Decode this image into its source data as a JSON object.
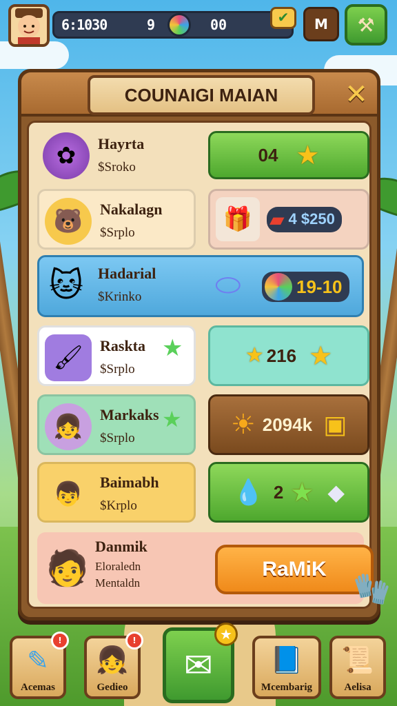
{
  "hud": {
    "score": "6:1030",
    "level": "9",
    "counter": "00",
    "menu_label": "M",
    "check_icon": "checkmark-icon",
    "tool_icon": "hammer-icon"
  },
  "panel": {
    "title": "COUNAIGI MAIAN",
    "close_label": "✕"
  },
  "rows": [
    {
      "name": "Hayrta",
      "sub": "$Sroko",
      "value": "04",
      "icon": "puzzle-pieces-icon"
    },
    {
      "name": "Nakalagn",
      "sub": "$Srplo",
      "value": "4 $250",
      "icon": "bear-icon"
    },
    {
      "name": "Hadarial",
      "sub": "$Krinko",
      "value": "19-10",
      "icon": "cat-icon"
    },
    {
      "name": "Raskta",
      "sub": "$Srplo",
      "value": "216",
      "icon": "brush-gem-icon"
    },
    {
      "name": "Markaks",
      "sub": "$Srplo",
      "value": "2094k",
      "icon": "girl-avatar-icon"
    },
    {
      "name": "Baimabh",
      "sub": "$Krplo",
      "value": "2",
      "icon": "boy-avatar-icon"
    },
    {
      "name": "Danmik",
      "sub": "Eloraledn",
      "sub2": "Mentaldn",
      "value": "RaMiK",
      "icon": "character-avatar-icon"
    }
  ],
  "nav": {
    "items": [
      {
        "label": "Acemas",
        "icon": "tool-icon",
        "badge": "!"
      },
      {
        "label": "Gedieo",
        "icon": "friend-icon",
        "badge": "!"
      },
      {
        "label": "",
        "icon": "map-icon"
      },
      {
        "label": "Mcembarig",
        "icon": "book-icon"
      },
      {
        "label": "Aelisa",
        "icon": "scroll-icon"
      }
    ]
  },
  "colors": {
    "wood": "#8b5a2b",
    "parchment": "#f3e0bb",
    "green": "#3f9a2f",
    "gold": "#f7c21a"
  }
}
